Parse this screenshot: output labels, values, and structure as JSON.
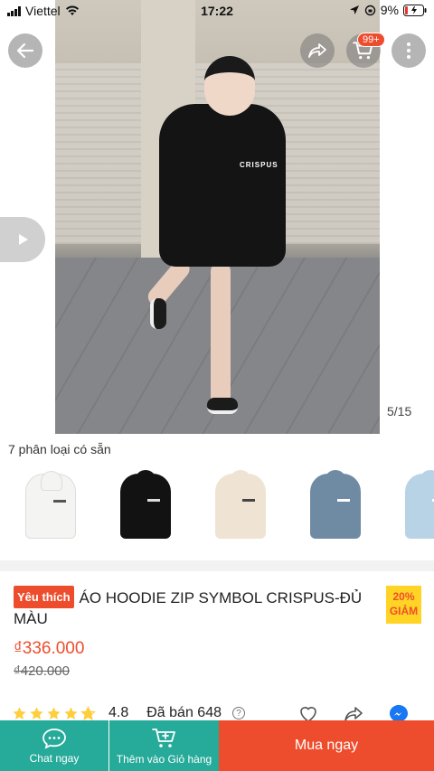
{
  "status_bar": {
    "carrier": "Viettel",
    "time": "17:22",
    "battery": "9%"
  },
  "header": {
    "cart_badge": "99+"
  },
  "gallery": {
    "counter": "5/15",
    "print_text": "CRISPUS"
  },
  "variants": {
    "title": "7 phân loại có sẵn",
    "items": [
      {
        "color": "#f4f4f2"
      },
      {
        "color": "#121212"
      },
      {
        "color": "#efe4d4"
      },
      {
        "color": "#6e8ba3"
      },
      {
        "color": "#b9d3e6"
      }
    ]
  },
  "product": {
    "favorite_tag": "Yêu thích",
    "title": "ÁO HOODIE ZIP SYMBOL CRISPUS-ĐỦ MÀU",
    "discount_percent": "20%",
    "discount_label": "GIẢM",
    "price": "₫336.000",
    "old_price": "₫420.000",
    "rating": "4.8",
    "rating_stars": 4.8,
    "sold": "Đã bán 648"
  },
  "bottom_bar": {
    "chat_label": "Chat ngay",
    "add_cart_label": "Thêm vào Giỏ hàng",
    "buy_label": "Mua ngay"
  },
  "colors": {
    "brand": "#ee4d2d",
    "teal": "#26aa99",
    "star": "#ffce3d",
    "discount_bg": "#ffd424"
  }
}
